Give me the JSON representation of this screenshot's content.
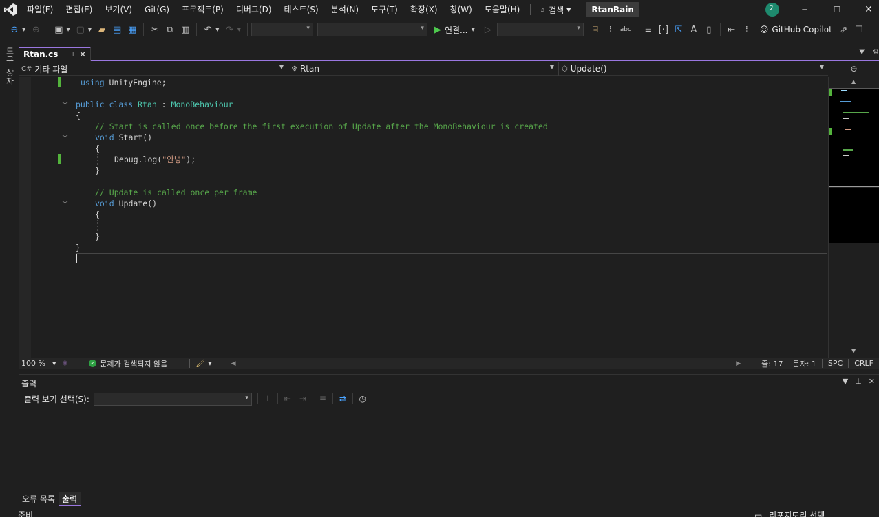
{
  "menu": {
    "items": [
      "파일(F)",
      "편집(E)",
      "보기(V)",
      "Git(G)",
      "프로젝트(P)",
      "디버그(D)",
      "테스트(S)",
      "분석(N)",
      "도구(T)",
      "확장(X)",
      "창(W)",
      "도움말(H)"
    ],
    "search_label": "검색",
    "solution_name": "RtanRain",
    "avatar_text": "가"
  },
  "toolbar": {
    "run_label": "연결...",
    "copilot_label": "GitHub Copilot"
  },
  "left_strip": {
    "label": "도구 상자"
  },
  "document": {
    "tab_name": "Rtan.cs",
    "nav": {
      "project": "기타 파일",
      "class": "Rtan",
      "member": "Update()"
    }
  },
  "code": {
    "line1_kw": "using",
    "line1_rest": " UnityEngine;",
    "line2_kw1": "public",
    "line2_kw2": "class",
    "line2_cls": "Rtan",
    "line2_colon": " : ",
    "line2_base": "MonoBehaviour",
    "brace_open": "{",
    "brace_close": "}",
    "comment_start": "// Start is called once before the first execution of Update after the MonoBehaviour is created",
    "start_kw": "void",
    "start_name": " Start()",
    "debug_prefix": "Debug.log(",
    "debug_string": "\"안녕\"",
    "debug_suffix": ");",
    "comment_update": "// Update is called once per frame",
    "update_kw": "void",
    "update_name": " Update()"
  },
  "editor_status": {
    "zoom": "100 %",
    "issues": "문제가 검색되지 않음",
    "line": "줄: 17",
    "col": "문자: 1",
    "whitespace": "SPC",
    "line_ending": "CRLF"
  },
  "output": {
    "title": "출력",
    "source_label": "출력 보기 선택(S):",
    "source_value": ""
  },
  "panel_tabs": [
    "오류 목록",
    "출력"
  ],
  "statusbar": {
    "left": "준비",
    "right": "리포지토리 선택"
  },
  "colors": {
    "accent": "#9a77e0",
    "keyword": "#569cd6",
    "type": "#4ec9b0",
    "comment": "#57a64a",
    "string": "#d69d85",
    "change_marker": "#53b33c"
  },
  "icons": [
    "vs-logo-icon",
    "search-icon",
    "minimize-icon",
    "maximize-icon",
    "close-icon",
    "back-icon",
    "forward-icon",
    "new-item-icon",
    "open-folder-icon",
    "save-icon",
    "save-all-icon",
    "cut-icon",
    "copy-icon",
    "paste-icon",
    "undo-icon",
    "redo-icon",
    "play-icon",
    "copilot-icon"
  ]
}
